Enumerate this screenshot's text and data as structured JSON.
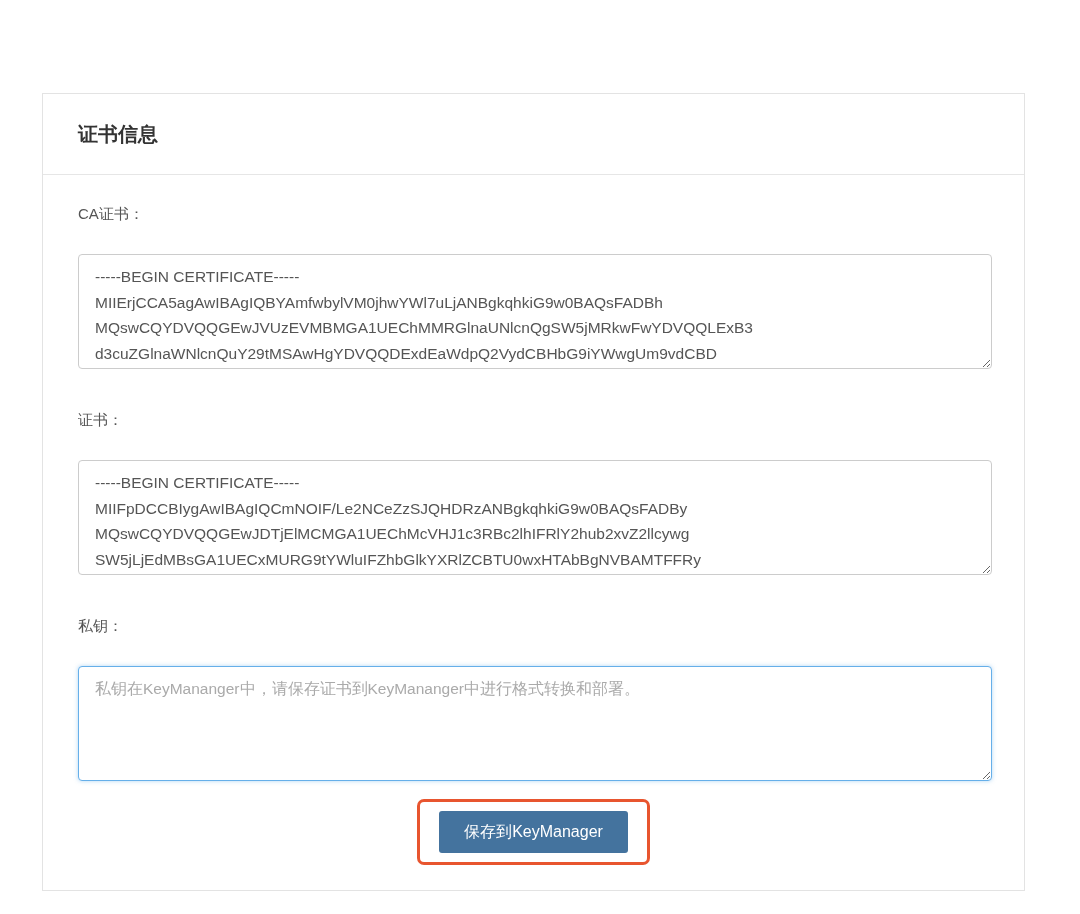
{
  "card": {
    "title": "证书信息"
  },
  "fields": [
    {
      "label": "CA证书：",
      "lines": [
        "-----BEGIN CERTIFICATE-----",
        "MIIErjCCA5agAwIBAgIQBYAmfwbylVM0jhwYWl7uLjANBgkqhkiG9w0BAQsFADBh",
        "MQswCQYDVQQGEwJVUzEVMBMGA1UEChMMRGlnaUNlcnQgSW5jMRkwFwYDVQQLExB3",
        "d3cuZGlnaWNlcnQuY29tMSAwHgYDVQQDExdEaWdpQ2VydCBHbG9iYWwgUm9vdCBD"
      ],
      "focused": false
    },
    {
      "label": "证书：",
      "lines": [
        "-----BEGIN CERTIFICATE-----",
        "MIIFpDCCBIygAwIBAgIQCmNOIF/Le2NCeZzSJQHDRzANBgkqhkiG9w0BAQsFADBy",
        "MQswCQYDVQQGEwJDTjElMCMGA1UEChMcVHJ1c3RBc2lhIFRlY2hub2xvZ2llcywg",
        "SW5jLjEdMBsGA1UECxMURG9tYWluIFZhbGlkYXRlZCBTU0wxHTAbBgNVBAMTFFRy"
      ],
      "focused": false
    },
    {
      "label": "私钥：",
      "placeholder": "私钥在KeyMananger中，请保存证书到KeyMananger中进行格式转换和部署。",
      "focused": true
    }
  ],
  "save_button": {
    "label": "保存到KeyManager",
    "highlighted": true
  }
}
